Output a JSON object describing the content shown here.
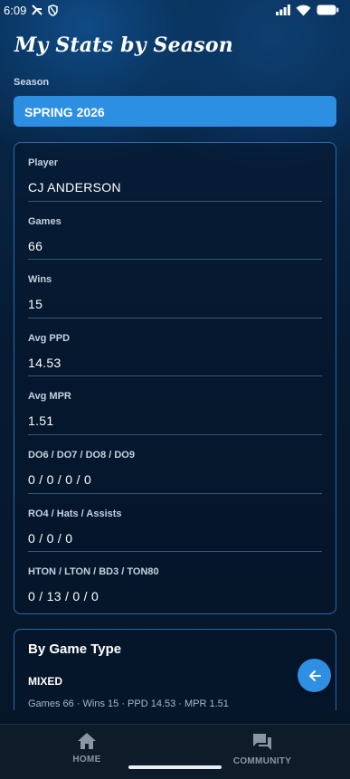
{
  "status_bar": {
    "time": "6:09"
  },
  "header": {
    "title": "My Stats by Season"
  },
  "season": {
    "label": "Season",
    "selected": "SPRING 2026"
  },
  "stats": [
    {
      "label": "Player",
      "value": "CJ ANDERSON"
    },
    {
      "label": "Games",
      "value": "66"
    },
    {
      "label": "Wins",
      "value": "15"
    },
    {
      "label": "Avg PPD",
      "value": "14.53"
    },
    {
      "label": "Avg MPR",
      "value": "1.51"
    },
    {
      "label": "DO6 / DO7 / DO8 / DO9",
      "value": "0 / 0 / 0 / 0"
    },
    {
      "label": "RO4 / Hats / Assists",
      "value": "0 / 0 / 0"
    },
    {
      "label": "HTON / LTON / BD3 / TON80",
      "value": "0 / 13 / 0 / 0"
    }
  ],
  "game_type": {
    "title": "By Game Type",
    "items": [
      {
        "name": "MIXED",
        "summary": "Games 66 · Wins 15 · PPD 14.53 · MPR 1.51"
      }
    ]
  },
  "fab": {
    "icon": "arrow-left-icon"
  },
  "bottom_nav": {
    "items": [
      {
        "label": "HOME",
        "icon": "home-icon"
      },
      {
        "label": "COMMUNITY",
        "icon": "community-icon"
      }
    ]
  },
  "colors": {
    "accent": "#2d8fe2",
    "background": "#071c34",
    "card_border": "#2a6aa8"
  }
}
